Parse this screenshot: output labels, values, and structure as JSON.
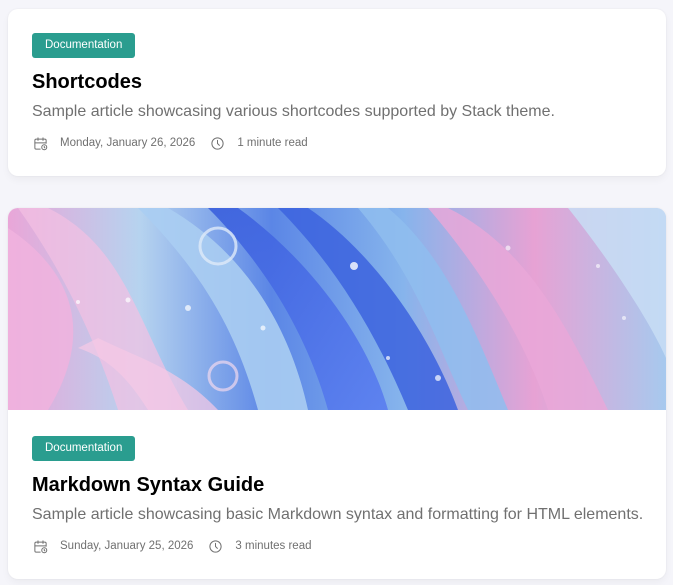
{
  "articles": [
    {
      "category": "Documentation",
      "title": "Shortcodes",
      "subtitle": "Sample article showcasing various shortcodes supported by Stack theme.",
      "date": "Monday, January 26, 2026",
      "reading_time": "1 minute read",
      "icons": {
        "date": "calendar-clock-icon",
        "reading_time": "clock-icon"
      }
    },
    {
      "category": "Documentation",
      "title": "Markdown Syntax Guide",
      "subtitle": "Sample article showcasing basic Markdown syntax and formatting for HTML elements.",
      "date": "Sunday, January 25, 2026",
      "reading_time": "3 minutes read",
      "icons": {
        "date": "calendar-clock-icon",
        "reading_time": "clock-icon"
      }
    }
  ],
  "colors": {
    "badge_background": "#2a9d8f",
    "badge_text": "#ffffff",
    "title": "#000000",
    "muted_text": "#707070",
    "card_background": "#ffffff",
    "page_background": "#f5f5fa"
  }
}
